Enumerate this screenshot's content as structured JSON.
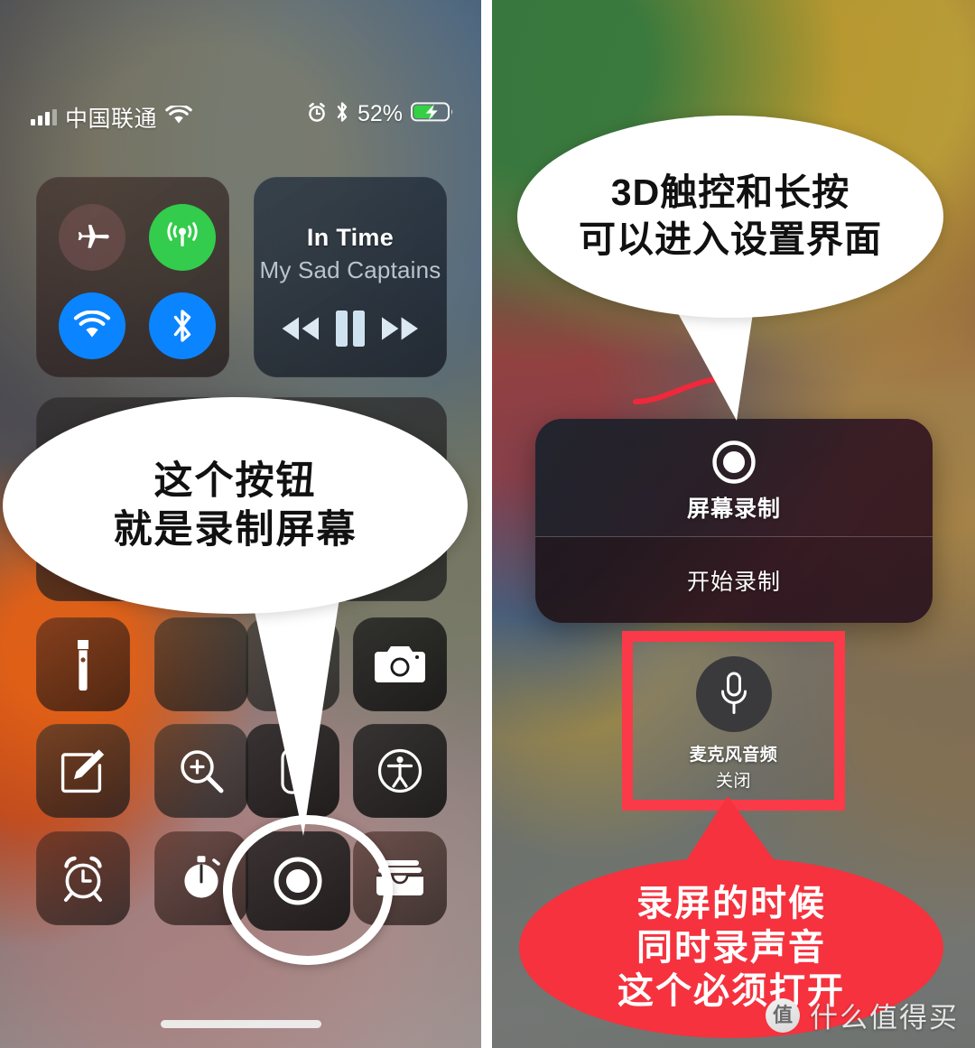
{
  "left_panel": {
    "status_bar": {
      "carrier": "中国联通",
      "battery_percent": "52%",
      "icons": [
        "signal-bars-icon",
        "wifi-icon",
        "alarm-icon",
        "bluetooth-icon",
        "battery-charging-icon"
      ]
    },
    "connectivity": {
      "airplane": {
        "name": "airplane-mode-toggle",
        "state": "off",
        "color": "#7c5656"
      },
      "cellular": {
        "name": "cellular-data-toggle",
        "state": "on",
        "color": "#33cc4c"
      },
      "wifi": {
        "name": "wifi-toggle",
        "state": "on",
        "color": "#0b84ff"
      },
      "bluetooth": {
        "name": "bluetooth-toggle",
        "state": "on",
        "color": "#0b84ff"
      }
    },
    "music": {
      "title": "In Time",
      "artist": "My Sad Captains",
      "controls": [
        "rewind-button",
        "pause-button",
        "fast-forward-button"
      ]
    },
    "tiles": [
      {
        "name": "flashlight-tile",
        "icon": "flashlight-icon"
      },
      {
        "name": "camera-tile",
        "icon": "camera-icon"
      },
      {
        "name": "notes-tile",
        "icon": "note-edit-icon"
      },
      {
        "name": "magnifier-tile",
        "icon": "magnifier-plus-icon"
      },
      {
        "name": "remote-tile",
        "icon": "apple-tv-remote-icon"
      },
      {
        "name": "accessibility-tile",
        "icon": "accessibility-icon"
      },
      {
        "name": "alarm-tile",
        "icon": "alarm-clock-icon"
      },
      {
        "name": "timer-tile",
        "icon": "timer-icon"
      },
      {
        "name": "screen-record-tile",
        "icon": "record-icon"
      },
      {
        "name": "wallet-tile",
        "icon": "wallet-icon"
      }
    ],
    "callout": {
      "line1": "这个按钮",
      "line2": "就是录制屏幕",
      "color": "#ffffff"
    }
  },
  "right_panel": {
    "callout_top": {
      "line1": "3D触控和长按",
      "line2": "可以进入设置界面",
      "color": "#ffffff"
    },
    "sheet": {
      "title": "屏幕录制",
      "action": "开始录制",
      "record_icon": "record-icon"
    },
    "microphone": {
      "icon": "microphone-icon",
      "label": "麦克风音频",
      "state": "关闭",
      "highlight_color": "#fa3a48"
    },
    "callout_bottom": {
      "line1": "录屏的时候",
      "line2": "同时录声音",
      "line3": "这个必须打开",
      "color": "#f5323e"
    }
  },
  "watermark": {
    "logo_char": "值",
    "text": "什么值得买"
  }
}
